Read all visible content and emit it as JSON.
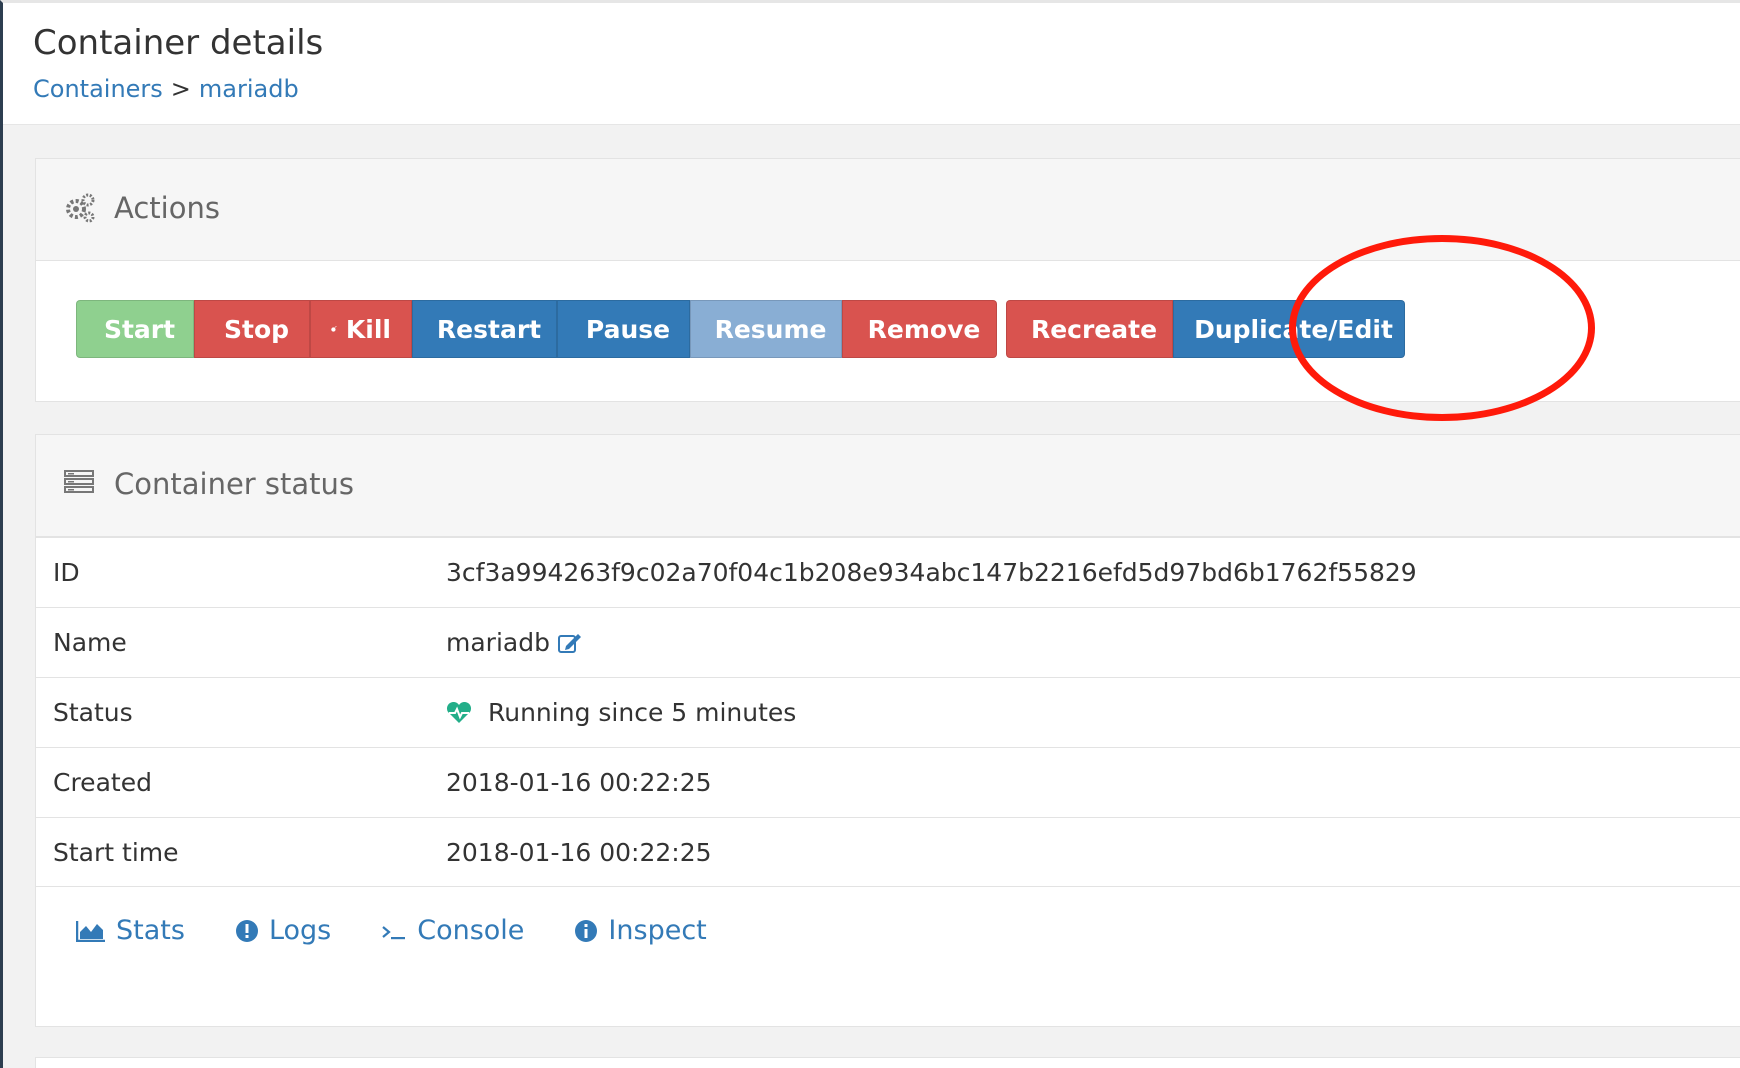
{
  "header": {
    "title": "Container details",
    "breadcrumb": {
      "parent": "Containers",
      "separator": ">",
      "current": "mariadb"
    }
  },
  "actions": {
    "title": "Actions",
    "icon": "gears-icon",
    "buttons": {
      "start": "Start",
      "stop": "Stop",
      "kill": "Kill",
      "restart": "Restart",
      "pause": "Pause",
      "resume": "Resume",
      "remove": "Remove",
      "recreate": "Recreate",
      "duplicate": "Duplicate/Edit"
    }
  },
  "status": {
    "title": "Container status",
    "icon": "server-icon",
    "rows": [
      {
        "label": "ID",
        "value": "3cf3a994263f9c02a70f04c1b208e934abc147b2216efd5d97bd6b1762f55829"
      },
      {
        "label": "Name",
        "value": "mariadb"
      },
      {
        "label": "Status",
        "value": "Running since 5 minutes"
      },
      {
        "label": "Created",
        "value": "2018-01-16 00:22:25"
      },
      {
        "label": "Start time",
        "value": "2018-01-16 00:22:25"
      }
    ],
    "links": {
      "stats": "Stats",
      "logs": "Logs",
      "console": "Console",
      "inspect": "Inspect"
    }
  },
  "colors": {
    "success": "#8fd08f",
    "danger": "#d9534f",
    "primary": "#337ab7",
    "primary_disabled": "#89aed4",
    "link": "#337ab7",
    "running": "#23ae89",
    "annotation": "#ff1a0a"
  }
}
